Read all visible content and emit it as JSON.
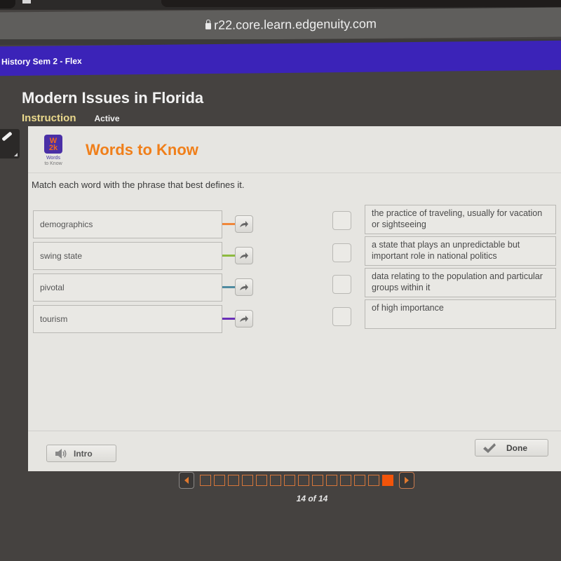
{
  "browser": {
    "url": "r22.core.learn.edgenuity.com"
  },
  "course": {
    "title": "History Sem 2 - Flex"
  },
  "lesson": {
    "title": "Modern Issues in Florida",
    "tabs": [
      {
        "label": "Instruction",
        "active": true
      },
      {
        "label": "Active",
        "active": false
      }
    ]
  },
  "activity": {
    "logo_text": [
      "W",
      "2k"
    ],
    "logo_caption": "Words",
    "logo_caption_sub": "to Know",
    "title": "Words to Know",
    "instructions": "Match each word with the phrase that best defines it.",
    "accent_color": "#f07f1a"
  },
  "words": [
    {
      "label": "demographics",
      "color": "#f0873a"
    },
    {
      "label": "swing state",
      "color": "#8dba3f"
    },
    {
      "label": "pivotal",
      "color": "#4f8ba0"
    },
    {
      "label": "tourism",
      "color": "#6a2fb8"
    }
  ],
  "definitions": [
    {
      "label": "the practice of traveling, usually for vacation or sightseeing"
    },
    {
      "label": "a state that plays an unpredictable but important role in national politics"
    },
    {
      "label": "data relating to the population and particular groups within it"
    },
    {
      "label": "of high importance"
    }
  ],
  "footer": {
    "intro_label": "Intro",
    "done_label": "Done"
  },
  "pager": {
    "total": 14,
    "current": 14,
    "indicator": "14 of 14",
    "active_color": "#f2540a"
  }
}
